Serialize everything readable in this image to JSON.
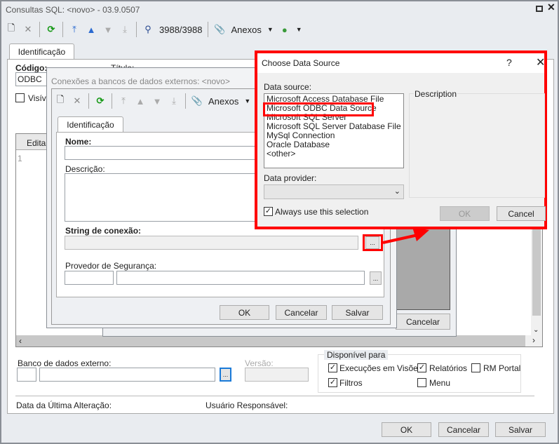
{
  "main": {
    "title": "Consultas SQL: <novo> - 03.9.0507",
    "counter": "3988/3988",
    "attachments": "Anexos",
    "tab": "Identificação",
    "codigo_label": "Código:",
    "codigo_value": "ODBC",
    "titulo_label": "Título:",
    "visivel_label": "Visível",
    "editor_tab": "Editar",
    "line_number": "1",
    "banco_label": "Banco de dados externo:",
    "versao_label": "Versão:",
    "disponivel_label": "Disponível para",
    "options": [
      {
        "label": "Execuções em Visões",
        "checked": true
      },
      {
        "label": "Relatórios",
        "checked": true
      },
      {
        "label": "RM Portal",
        "checked": false
      },
      {
        "label": "Filtros",
        "checked": true
      },
      {
        "label": "Menu",
        "checked": false
      }
    ],
    "data_alteracao_label": "Data da Última Alteração:",
    "usuario_label": "Usuário Responsável:",
    "ok": "OK",
    "cancelar": "Cancelar",
    "salvar": "Salvar",
    "behind_cancelar": "Cancelar"
  },
  "conexoes": {
    "title": "Conexões a bancos de dados externos: <novo>",
    "attachments": "Anexos",
    "tab": "Identificação",
    "nome_label": "Nome:",
    "descricao_label": "Descrição:",
    "string_label": "String de conexão:",
    "provedor_label": "Provedor de Segurança:",
    "ellipsis": "...",
    "ok": "OK",
    "cancelar": "Cancelar",
    "salvar": "Salvar"
  },
  "choose": {
    "title": "Choose Data Source",
    "help": "?",
    "data_source_label": "Data source:",
    "sources": [
      "Microsoft Access Database File",
      "Microsoft ODBC Data Source",
      "Microsoft SQL Server",
      "Microsoft SQL Server Database File",
      "MySql Connection",
      "Oracle Database",
      "<other>"
    ],
    "description_label": "Description",
    "provider_label": "Data provider:",
    "always_label": "Always use this selection",
    "ok": "OK",
    "cancel": "Cancel"
  },
  "colors": {
    "highlight": "#ff0000"
  }
}
